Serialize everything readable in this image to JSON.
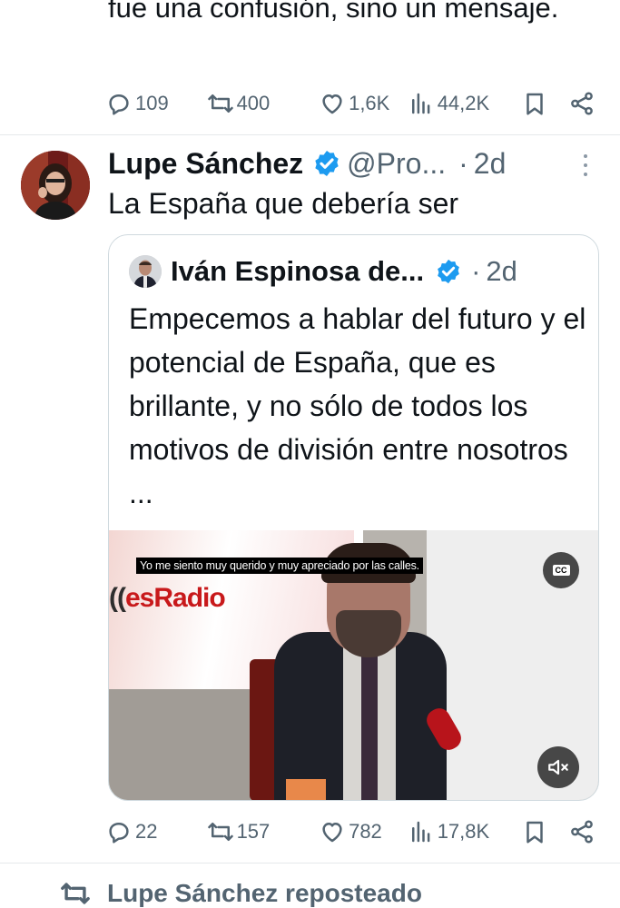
{
  "previous_tweet": {
    "text": "fue una confusión, sino un mensaje.",
    "stats": {
      "replies": "109",
      "reposts": "400",
      "likes": "1,6K",
      "views": "44,2K"
    }
  },
  "tweet": {
    "author_name": "Lupe Sánchez",
    "handle": "@Pro...",
    "separator": "·",
    "age": "2d",
    "text": "La España que debería ser",
    "quote": {
      "author_name": "Iván Espinosa de...",
      "separator": "·",
      "age": "2d",
      "text": "Empecemos a hablar del futuro y el potencial de España, que es brillante, y no sólo de todos los motivos de división entre nosotros ...",
      "video": {
        "subtitle": "Yo me siento muy querido y muy apreciado por las calles.",
        "cc_label": "CC",
        "logo_prefix": "((",
        "logo_text": "esRadio"
      }
    },
    "stats": {
      "replies": "22",
      "reposts": "157",
      "likes": "782",
      "views": "17,8K"
    }
  },
  "next_item": {
    "repost_label": "Lupe Sánchez reposteado"
  },
  "colors": {
    "verified": "#1d9bf0",
    "secondary_text": "#536471",
    "divider": "#e6e9eb"
  }
}
